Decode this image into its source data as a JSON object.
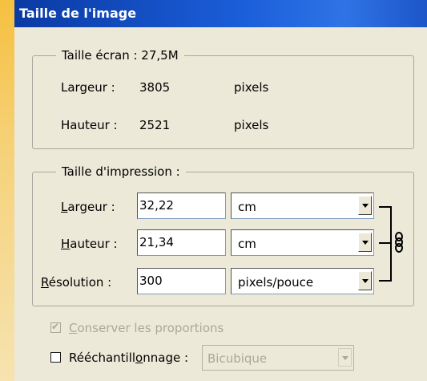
{
  "dialog": {
    "title": "Taille de l'image"
  },
  "pixel_group": {
    "legend": "Taille écran : 27,5M",
    "width_label": "Largeur :",
    "width_value": "3805",
    "width_unit": "pixels",
    "height_label": "Hauteur :",
    "height_value": "2521",
    "height_unit": "pixels"
  },
  "print_group": {
    "legend": "Taille d'impression :",
    "width_label_u": "L",
    "width_label_rest": "argeur :",
    "width_value": "32,22",
    "width_unit": "cm",
    "height_label_u": "H",
    "height_label_rest": "auteur :",
    "height_value": "21,34",
    "height_unit": "cm",
    "resolution_label_u": "R",
    "resolution_label_rest": "ésolution :",
    "resolution_value": "300",
    "resolution_unit": "pixels/pouce"
  },
  "constrain": {
    "label_u": "C",
    "label_rest": "onserver les proportions",
    "checked": true,
    "enabled": false
  },
  "resample": {
    "label_a": "Rééchantill",
    "label_u": "o",
    "label_b": "nnage :",
    "checked": false,
    "method": "Bicubique"
  },
  "icons": {
    "link": "chain-link-icon",
    "dropdown": "chevron-down-icon"
  }
}
